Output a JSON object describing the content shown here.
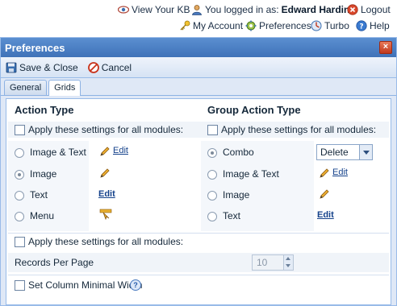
{
  "topbar": {
    "view_kb": "View Your KB",
    "logged_in_as": "You logged in as:",
    "username": "Edward Hardin",
    "logout": "Logout",
    "my_account": "My Account",
    "preferences": "Preferences",
    "turbo": "Turbo",
    "help": "Help"
  },
  "window": {
    "title": "Preferences",
    "close_glyph": "×",
    "toolbar": {
      "save_close": "Save & Close",
      "cancel": "Cancel"
    },
    "tabs": [
      {
        "label": "General",
        "active": false
      },
      {
        "label": "Grids",
        "active": true
      }
    ]
  },
  "grids": {
    "action_type": {
      "heading": "Action Type",
      "apply_all_label": "Apply these settings for all modules:",
      "options": [
        {
          "label": "Image & Text",
          "selected": false,
          "edit_label": "Edit"
        },
        {
          "label": "Image",
          "selected": true
        },
        {
          "label": "Text",
          "selected": false,
          "edit_label": "Edit"
        },
        {
          "label": "Menu",
          "selected": false
        }
      ]
    },
    "group_action_type": {
      "heading": "Group Action Type",
      "apply_all_label": "Apply these settings for all modules:",
      "options": [
        {
          "label": "Combo",
          "selected": true,
          "select_value": "Delete"
        },
        {
          "label": "Image & Text",
          "selected": false,
          "edit_label": "Edit"
        },
        {
          "label": "Image",
          "selected": false
        },
        {
          "label": "Text",
          "selected": false,
          "edit_label": "Edit"
        }
      ]
    },
    "paging": {
      "apply_all_label": "Apply these settings for all modules:",
      "records_per_page_label": "Records Per Page",
      "records_per_page_value": "10"
    },
    "column_width": {
      "label": "Set Column Minimal Width",
      "help_glyph": "?"
    }
  },
  "colors": {
    "title_bar": "#3f72b8",
    "window_bg": "#dfe8f6",
    "link": "#15428b",
    "logout_red": "#c0391d"
  }
}
